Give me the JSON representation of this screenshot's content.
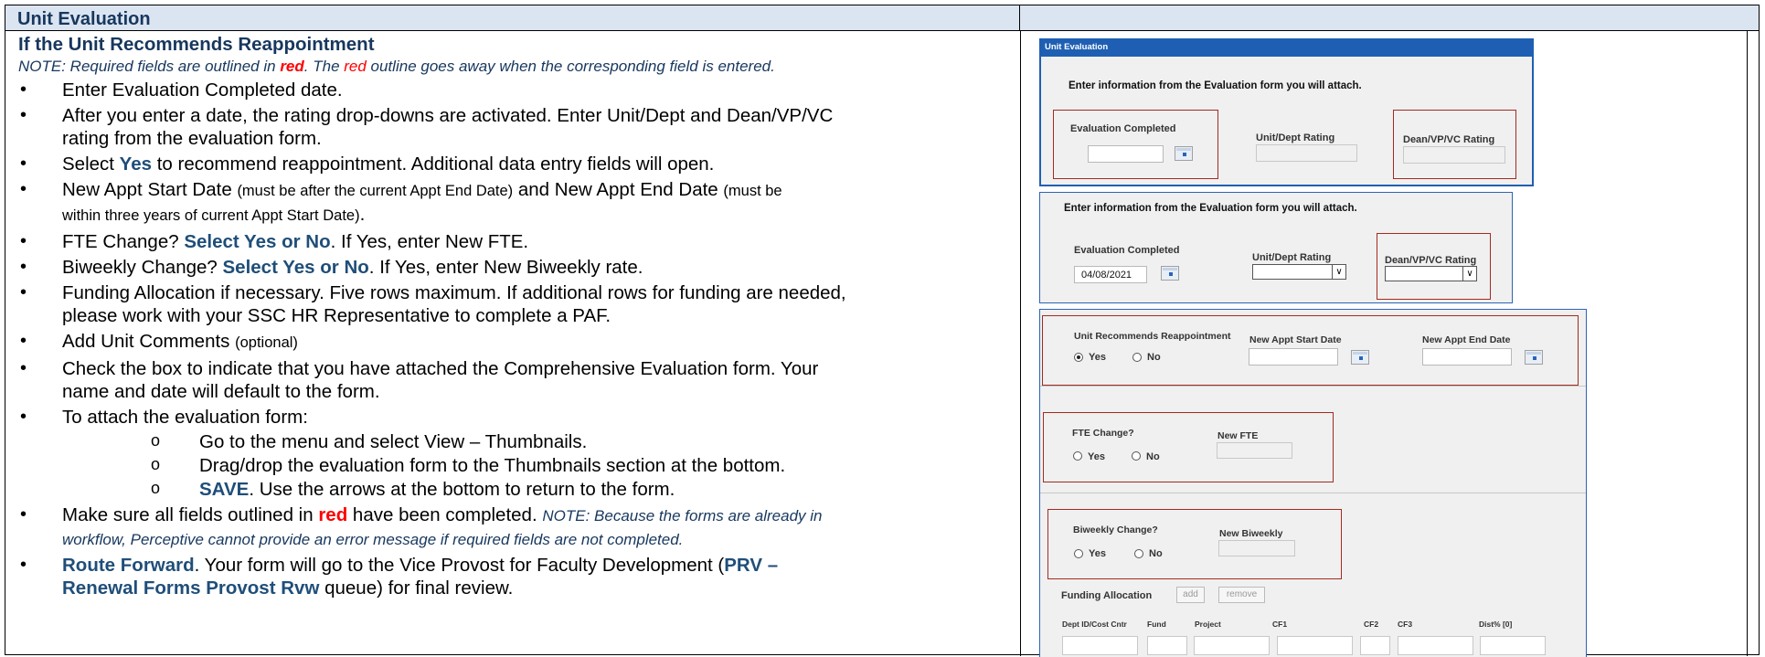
{
  "header": {
    "title": "Unit Evaluation"
  },
  "left": {
    "section_title": "If the Unit Recommends Reappointment",
    "note_a": "NOTE:  Required fields are outlined in ",
    "note_red": "red",
    "note_b": ".  The ",
    "note_red2": "red",
    "note_c": " outline goes away when the corresponding field is entered.",
    "b1": "Enter Evaluation Completed date.",
    "b2a": "After you enter a date, the rating drop-downs are activated.  Enter Unit/Dept and Dean/VP/VC",
    "b2b": "rating from the evaluation form.",
    "b3_pre": "Select ",
    "b3_yes": "Yes",
    "b3_post": " to recommend reappointment.  Additional data entry fields will open.",
    "b4_a": "New Appt Start Date ",
    "b4_b": "(must be after the current Appt End Date)",
    "b4_c": " and New Appt End Date ",
    "b4_d": "(must be",
    "b4_e": "within three years of current Appt Start Date)",
    "b4_f": ".",
    "b5_pre": "FTE Change? ",
    "b5_bold": "Select Yes or No",
    "b5_post": ".  If Yes, enter New FTE.",
    "b6_pre": "Biweekly Change?  ",
    "b6_bold": "Select Yes or No",
    "b6_post": ".  If Yes, enter New Biweekly rate.",
    "b7a": "Funding Allocation if necessary.  Five rows maximum. If additional rows for funding are needed,",
    "b7b": "please work with your SSC HR Representative to complete a PAF.",
    "b8_pre": "Add Unit Comments ",
    "b8_small": "(optional)",
    "b9a": "Check the box to indicate that you have attached the Comprehensive Evaluation form.  Your",
    "b9b": "name and date will default to the form.",
    "b10": "To attach the evaluation form:",
    "s1": "Go to the menu and select View – Thumbnails.",
    "s2": "Drag/drop the evaluation form to the Thumbnails section at the bottom.",
    "s3_bold": "SAVE",
    "s3_post": ".  Use the arrows at the bottom to return to the form.",
    "b11_pre": "Make sure all fields outlined in ",
    "b11_red": "red",
    "b11_mid": " have been completed.  ",
    "b11_note1": "NOTE:  Because the forms are already in",
    "b11_note2": "workflow, Perceptive cannot provide an error message if required fields are not completed.",
    "b12_bold": "Route Forward",
    "b12_a": ".  Your form will go to the Vice Provost for Faculty Development (",
    "b12_q1": "PRV –",
    "b12_q2": "Renewal Forms Provost Rvw",
    "b12_b": " queue) for final review."
  },
  "form1": {
    "title": "Unit Evaluation",
    "instr": "Enter information from the Evaluation form you will attach.",
    "eval_completed": "Evaluation Completed",
    "unit_rating": "Unit/Dept Rating",
    "dean_rating": "Dean/VP/VC Rating"
  },
  "form2": {
    "instr": "Enter information from the Evaluation form you will attach.",
    "eval_completed": "Evaluation Completed",
    "date_value": "04/08/2021",
    "unit_rating": "Unit/Dept Rating",
    "dean_rating": "Dean/VP/VC Rating"
  },
  "form3": {
    "reappoint": "Unit Recommends Reappointment",
    "yes": "Yes",
    "no": "No",
    "start": "New Appt Start Date",
    "end": "New Appt End Date",
    "fte_change": "FTE Change?",
    "new_fte": "New FTE",
    "biweekly_change": "Biweekly Change?",
    "new_biweekly": "New Biweekly",
    "funding": "Funding Allocation",
    "add": "add",
    "remove": "remove",
    "cols": [
      "Dept ID/Cost Cntr",
      "Fund",
      "Project",
      "CF1",
      "CF2",
      "CF3",
      "Dist% [0]"
    ]
  },
  "colors": {
    "header_bg": "#dbe5f1",
    "title_blue": "#17375e",
    "required_red": "#a32b20",
    "form_title_bar": "#1f5fb3"
  }
}
